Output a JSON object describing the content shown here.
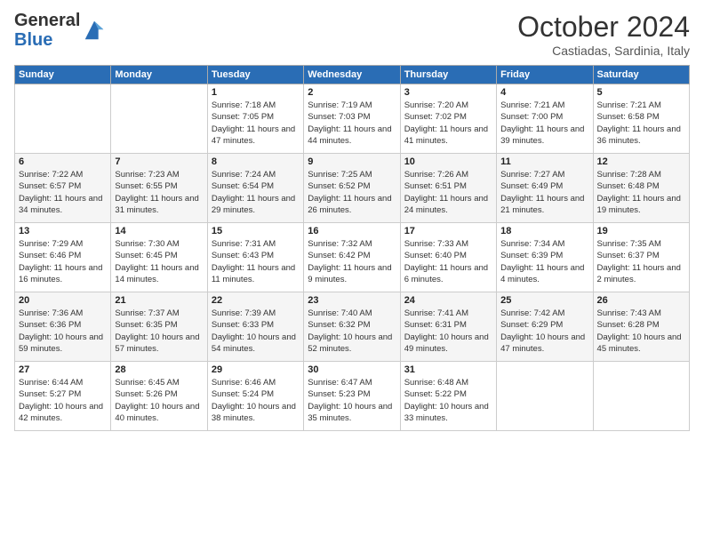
{
  "header": {
    "logo_general": "General",
    "logo_blue": "Blue",
    "title": "October 2024",
    "location": "Castiadas, Sardinia, Italy"
  },
  "days_of_week": [
    "Sunday",
    "Monday",
    "Tuesday",
    "Wednesday",
    "Thursday",
    "Friday",
    "Saturday"
  ],
  "weeks": [
    [
      {
        "day": "",
        "sunrise": "",
        "sunset": "",
        "daylight": ""
      },
      {
        "day": "",
        "sunrise": "",
        "sunset": "",
        "daylight": ""
      },
      {
        "day": "1",
        "sunrise": "Sunrise: 7:18 AM",
        "sunset": "Sunset: 7:05 PM",
        "daylight": "Daylight: 11 hours and 47 minutes."
      },
      {
        "day": "2",
        "sunrise": "Sunrise: 7:19 AM",
        "sunset": "Sunset: 7:03 PM",
        "daylight": "Daylight: 11 hours and 44 minutes."
      },
      {
        "day": "3",
        "sunrise": "Sunrise: 7:20 AM",
        "sunset": "Sunset: 7:02 PM",
        "daylight": "Daylight: 11 hours and 41 minutes."
      },
      {
        "day": "4",
        "sunrise": "Sunrise: 7:21 AM",
        "sunset": "Sunset: 7:00 PM",
        "daylight": "Daylight: 11 hours and 39 minutes."
      },
      {
        "day": "5",
        "sunrise": "Sunrise: 7:21 AM",
        "sunset": "Sunset: 6:58 PM",
        "daylight": "Daylight: 11 hours and 36 minutes."
      }
    ],
    [
      {
        "day": "6",
        "sunrise": "Sunrise: 7:22 AM",
        "sunset": "Sunset: 6:57 PM",
        "daylight": "Daylight: 11 hours and 34 minutes."
      },
      {
        "day": "7",
        "sunrise": "Sunrise: 7:23 AM",
        "sunset": "Sunset: 6:55 PM",
        "daylight": "Daylight: 11 hours and 31 minutes."
      },
      {
        "day": "8",
        "sunrise": "Sunrise: 7:24 AM",
        "sunset": "Sunset: 6:54 PM",
        "daylight": "Daylight: 11 hours and 29 minutes."
      },
      {
        "day": "9",
        "sunrise": "Sunrise: 7:25 AM",
        "sunset": "Sunset: 6:52 PM",
        "daylight": "Daylight: 11 hours and 26 minutes."
      },
      {
        "day": "10",
        "sunrise": "Sunrise: 7:26 AM",
        "sunset": "Sunset: 6:51 PM",
        "daylight": "Daylight: 11 hours and 24 minutes."
      },
      {
        "day": "11",
        "sunrise": "Sunrise: 7:27 AM",
        "sunset": "Sunset: 6:49 PM",
        "daylight": "Daylight: 11 hours and 21 minutes."
      },
      {
        "day": "12",
        "sunrise": "Sunrise: 7:28 AM",
        "sunset": "Sunset: 6:48 PM",
        "daylight": "Daylight: 11 hours and 19 minutes."
      }
    ],
    [
      {
        "day": "13",
        "sunrise": "Sunrise: 7:29 AM",
        "sunset": "Sunset: 6:46 PM",
        "daylight": "Daylight: 11 hours and 16 minutes."
      },
      {
        "day": "14",
        "sunrise": "Sunrise: 7:30 AM",
        "sunset": "Sunset: 6:45 PM",
        "daylight": "Daylight: 11 hours and 14 minutes."
      },
      {
        "day": "15",
        "sunrise": "Sunrise: 7:31 AM",
        "sunset": "Sunset: 6:43 PM",
        "daylight": "Daylight: 11 hours and 11 minutes."
      },
      {
        "day": "16",
        "sunrise": "Sunrise: 7:32 AM",
        "sunset": "Sunset: 6:42 PM",
        "daylight": "Daylight: 11 hours and 9 minutes."
      },
      {
        "day": "17",
        "sunrise": "Sunrise: 7:33 AM",
        "sunset": "Sunset: 6:40 PM",
        "daylight": "Daylight: 11 hours and 6 minutes."
      },
      {
        "day": "18",
        "sunrise": "Sunrise: 7:34 AM",
        "sunset": "Sunset: 6:39 PM",
        "daylight": "Daylight: 11 hours and 4 minutes."
      },
      {
        "day": "19",
        "sunrise": "Sunrise: 7:35 AM",
        "sunset": "Sunset: 6:37 PM",
        "daylight": "Daylight: 11 hours and 2 minutes."
      }
    ],
    [
      {
        "day": "20",
        "sunrise": "Sunrise: 7:36 AM",
        "sunset": "Sunset: 6:36 PM",
        "daylight": "Daylight: 10 hours and 59 minutes."
      },
      {
        "day": "21",
        "sunrise": "Sunrise: 7:37 AM",
        "sunset": "Sunset: 6:35 PM",
        "daylight": "Daylight: 10 hours and 57 minutes."
      },
      {
        "day": "22",
        "sunrise": "Sunrise: 7:39 AM",
        "sunset": "Sunset: 6:33 PM",
        "daylight": "Daylight: 10 hours and 54 minutes."
      },
      {
        "day": "23",
        "sunrise": "Sunrise: 7:40 AM",
        "sunset": "Sunset: 6:32 PM",
        "daylight": "Daylight: 10 hours and 52 minutes."
      },
      {
        "day": "24",
        "sunrise": "Sunrise: 7:41 AM",
        "sunset": "Sunset: 6:31 PM",
        "daylight": "Daylight: 10 hours and 49 minutes."
      },
      {
        "day": "25",
        "sunrise": "Sunrise: 7:42 AM",
        "sunset": "Sunset: 6:29 PM",
        "daylight": "Daylight: 10 hours and 47 minutes."
      },
      {
        "day": "26",
        "sunrise": "Sunrise: 7:43 AM",
        "sunset": "Sunset: 6:28 PM",
        "daylight": "Daylight: 10 hours and 45 minutes."
      }
    ],
    [
      {
        "day": "27",
        "sunrise": "Sunrise: 6:44 AM",
        "sunset": "Sunset: 5:27 PM",
        "daylight": "Daylight: 10 hours and 42 minutes."
      },
      {
        "day": "28",
        "sunrise": "Sunrise: 6:45 AM",
        "sunset": "Sunset: 5:26 PM",
        "daylight": "Daylight: 10 hours and 40 minutes."
      },
      {
        "day": "29",
        "sunrise": "Sunrise: 6:46 AM",
        "sunset": "Sunset: 5:24 PM",
        "daylight": "Daylight: 10 hours and 38 minutes."
      },
      {
        "day": "30",
        "sunrise": "Sunrise: 6:47 AM",
        "sunset": "Sunset: 5:23 PM",
        "daylight": "Daylight: 10 hours and 35 minutes."
      },
      {
        "day": "31",
        "sunrise": "Sunrise: 6:48 AM",
        "sunset": "Sunset: 5:22 PM",
        "daylight": "Daylight: 10 hours and 33 minutes."
      },
      {
        "day": "",
        "sunrise": "",
        "sunset": "",
        "daylight": ""
      },
      {
        "day": "",
        "sunrise": "",
        "sunset": "",
        "daylight": ""
      }
    ]
  ]
}
